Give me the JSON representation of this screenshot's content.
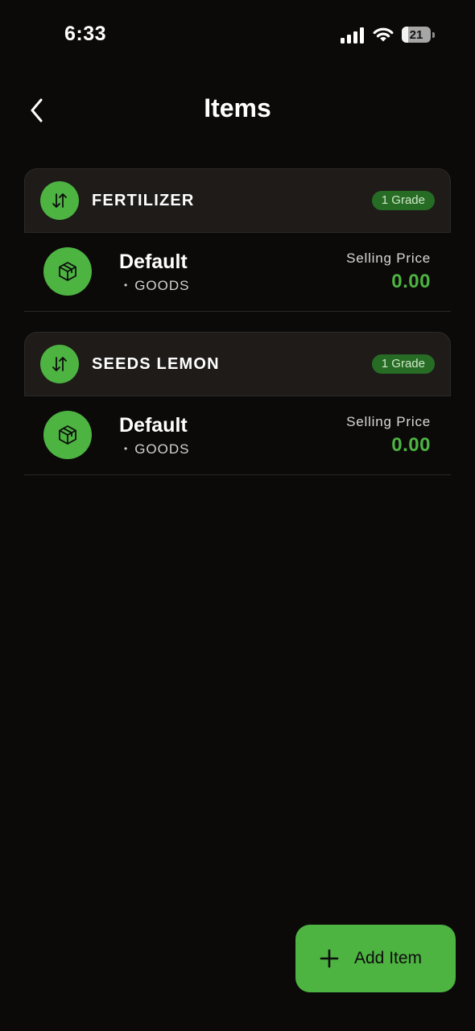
{
  "status_bar": {
    "time": "6:33",
    "battery_level": "21",
    "battery_fraction": 0.21
  },
  "header": {
    "title": "Items",
    "back_icon": "chevron-left-icon"
  },
  "groups": [
    {
      "name": "FERTILIZER",
      "badge": "1 Grade",
      "icon": "sort-arrows-icon",
      "items": [
        {
          "name": "Default",
          "type": "GOODS",
          "price_label": "Selling Price",
          "price": "0.00",
          "icon": "package-icon"
        }
      ]
    },
    {
      "name": "SEEDS LEMON",
      "badge": "1 Grade",
      "icon": "sort-arrows-icon",
      "items": [
        {
          "name": "Default",
          "type": "GOODS",
          "price_label": "Selling Price",
          "price": "0.00",
          "icon": "package-icon"
        }
      ]
    }
  ],
  "add_button": {
    "label": "Add Item",
    "icon": "plus-icon"
  },
  "colors": {
    "accent_green": "#4db341",
    "badge_green": "#276c25",
    "background": "#0b0a09",
    "header_card": "#1e1b19"
  }
}
